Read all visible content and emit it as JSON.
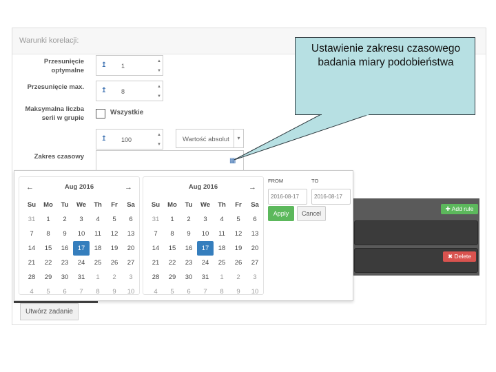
{
  "panel": {
    "title": "Warunki korelacji:"
  },
  "form": {
    "offset_opt_label": "Przesunięcie optymalne",
    "offset_opt_value": "1",
    "offset_max_label": "Przesunięcie max.",
    "offset_max_value": "8",
    "max_series_label": "Maksymalna liczba serii w grupie",
    "all_label": "Wszystkie",
    "series_value": "100",
    "select_value": "Wartość absolut",
    "date_range_label": "Zakres czasowy"
  },
  "calendars": [
    {
      "month": "Aug 2016",
      "dow": [
        "Su",
        "Mo",
        "Tu",
        "We",
        "Th",
        "Fr",
        "Sa"
      ],
      "days": [
        "31",
        "1",
        "2",
        "3",
        "4",
        "5",
        "6",
        "7",
        "8",
        "9",
        "10",
        "11",
        "12",
        "13",
        "14",
        "15",
        "16",
        "17",
        "18",
        "19",
        "20",
        "21",
        "22",
        "23",
        "24",
        "25",
        "26",
        "27",
        "28",
        "29",
        "30",
        "31",
        "1",
        "2",
        "3",
        "4",
        "5",
        "6",
        "7",
        "8",
        "9",
        "10"
      ]
    },
    {
      "month": "Aug 2016",
      "dow": [
        "Su",
        "Mo",
        "Tu",
        "We",
        "Th",
        "Fr",
        "Sa"
      ],
      "days": [
        "31",
        "1",
        "2",
        "3",
        "4",
        "5",
        "6",
        "7",
        "8",
        "9",
        "10",
        "11",
        "12",
        "13",
        "14",
        "15",
        "16",
        "17",
        "18",
        "19",
        "20",
        "21",
        "22",
        "23",
        "24",
        "25",
        "26",
        "27",
        "28",
        "29",
        "30",
        "31",
        "1",
        "2",
        "3",
        "4",
        "5",
        "6",
        "7",
        "8",
        "9",
        "10"
      ]
    }
  ],
  "range": {
    "from_label": "FROM",
    "to_label": "TO",
    "from_value": "2016-08-17",
    "to_value": "2016-08-17",
    "apply_label": "Apply",
    "cancel_label": "Cancel"
  },
  "rules": {
    "add_label": "Add rule",
    "delete_label": "Delete"
  },
  "create_task_label": "Utwórz zadanie",
  "callout": {
    "text": "Ustawienie zakresu czasowego badania miary podobieństwa"
  },
  "colors": {
    "selected_day": "#357ebd",
    "apply": "#5cb85c",
    "delete": "#d9534f",
    "callout_bg": "#b7e0e3"
  }
}
